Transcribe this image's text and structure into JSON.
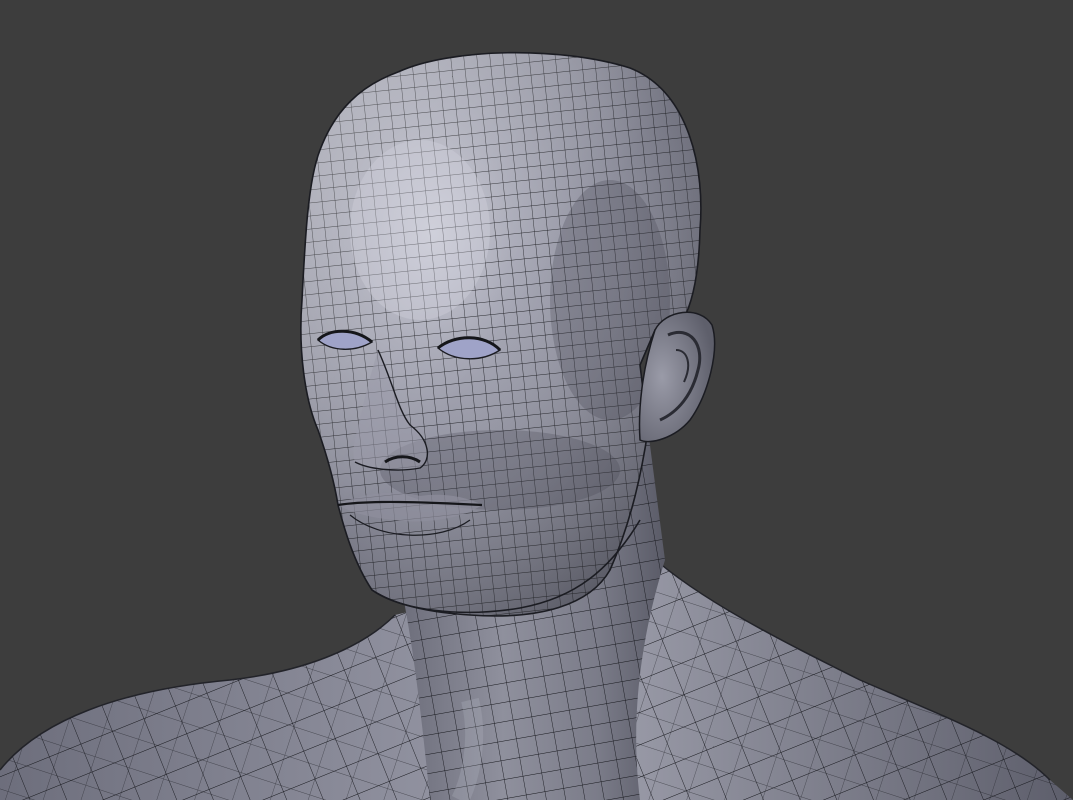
{
  "viewport": {
    "subject": "wireframe-head-bust",
    "background_color": "#3d3d3d",
    "mesh_base_color": "#8a8b99",
    "mesh_highlight_color": "#c4c5d1",
    "mesh_shadow_color": "#4b4c58",
    "wire_color": "#16171c",
    "eye_color": "#9fa3c8"
  }
}
